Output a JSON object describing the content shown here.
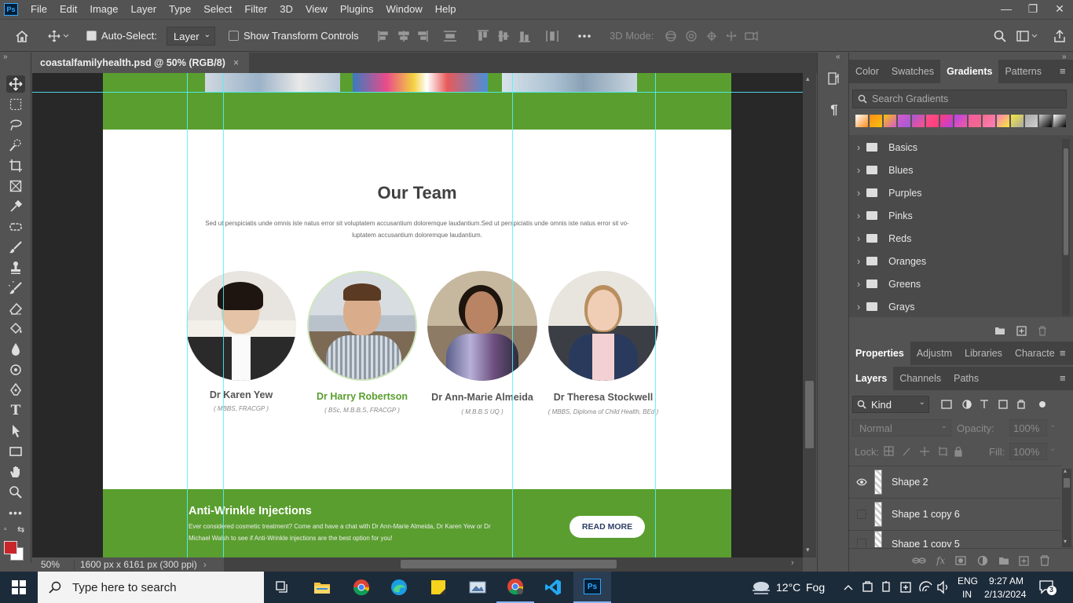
{
  "menu": [
    "File",
    "Edit",
    "Image",
    "Layer",
    "Type",
    "Select",
    "Filter",
    "3D",
    "View",
    "Plugins",
    "Window",
    "Help"
  ],
  "app_logo": "Ps",
  "options": {
    "auto_select_label": "Auto-Select:",
    "auto_select_value": "Layer",
    "transform_label": "Show Transform Controls",
    "mode_3d_label": "3D Mode:"
  },
  "document": {
    "tab_title": "coastalfamilyhealth.psd @ 50% (RGB/8)",
    "close": "×"
  },
  "canvas": {
    "team_title": "Our Team",
    "team_intro": "Sed ut perspiciatis unde omnis iste natus error sit voluptatem accusantium doloremque laudantium.Sed ut perspiciatis unde omnis iste natus error sit vo- luptatem accusantium doloremque laudantium.",
    "members": [
      {
        "name": "Dr Karen Yew",
        "creds": "( MBBS, FRACGP )",
        "highlight": false
      },
      {
        "name": "Dr Harry Robertson",
        "creds": "( BSc, M.B.B.S, FRACGP )",
        "highlight": true
      },
      {
        "name": "Dr Ann-Marie Almeida",
        "creds": "( M.B.B.S UQ )",
        "highlight": false
      },
      {
        "name": "Dr Theresa Stockwell",
        "creds": "( MBBS, Diploma of Child Health, BEd )",
        "highlight": false
      }
    ],
    "banner_title": "Anti-Wrinkle Injections",
    "banner_text": "Ever considered cosmetic treatment? Come and have a chat with Dr Ann-Marie Almeida, Dr Karen Yew or Dr Michael Walsh to see if Anti-Wrinkle injections are the best option for you!",
    "banner_button": "READ MORE"
  },
  "status": {
    "zoom": "50%",
    "doc_size": "1600 px x 6161 px (300 ppi)"
  },
  "gradients_panel": {
    "tabs": [
      "Color",
      "Swatches",
      "Gradients",
      "Patterns"
    ],
    "active": "Gradients",
    "search_placeholder": "Search Gradients",
    "folders": [
      "Basics",
      "Blues",
      "Purples",
      "Pinks",
      "Reds",
      "Oranges",
      "Greens",
      "Grays"
    ],
    "swatches": [
      "#ffffff",
      "#ff8c1a",
      "#f6c20c",
      "#d45acb",
      "#a35ad4",
      "#ff4f8b",
      "#ff3c7c",
      "#b642e3",
      "#f45aa2",
      "#f16c8b",
      "#ff7fb9",
      "#f7e93b",
      "#a8a8a8",
      "#d0d0d0",
      "#000000"
    ]
  },
  "properties_panel": {
    "tabs": [
      "Properties",
      "Adjustm",
      "Libraries",
      "Characte"
    ]
  },
  "layers_panel": {
    "tabs": [
      "Layers",
      "Channels",
      "Paths"
    ],
    "filter_kind": "Kind",
    "blend_mode": "Normal",
    "opacity_label": "Opacity:",
    "opacity_value": "100%",
    "lock_label": "Lock:",
    "fill_label": "Fill:",
    "fill_value": "100%",
    "layers": [
      {
        "name": "Shape 2",
        "visible": true
      },
      {
        "name": "Shape 1 copy 6",
        "visible": false
      },
      {
        "name": "Shape 1 copy 5",
        "visible": false
      }
    ]
  },
  "taskbar": {
    "search_placeholder": "Type here to search",
    "weather_temp": "12°C",
    "weather_desc": "Fog",
    "lang1": "ENG",
    "lang2": "IN",
    "time": "9:27 AM",
    "date": "2/13/2024",
    "notif_count": "3"
  },
  "colors": {
    "accent_green": "#5a9e2f",
    "guide": "#4ff3ff",
    "foreground": "#c8262b",
    "background": "#ffffff"
  }
}
